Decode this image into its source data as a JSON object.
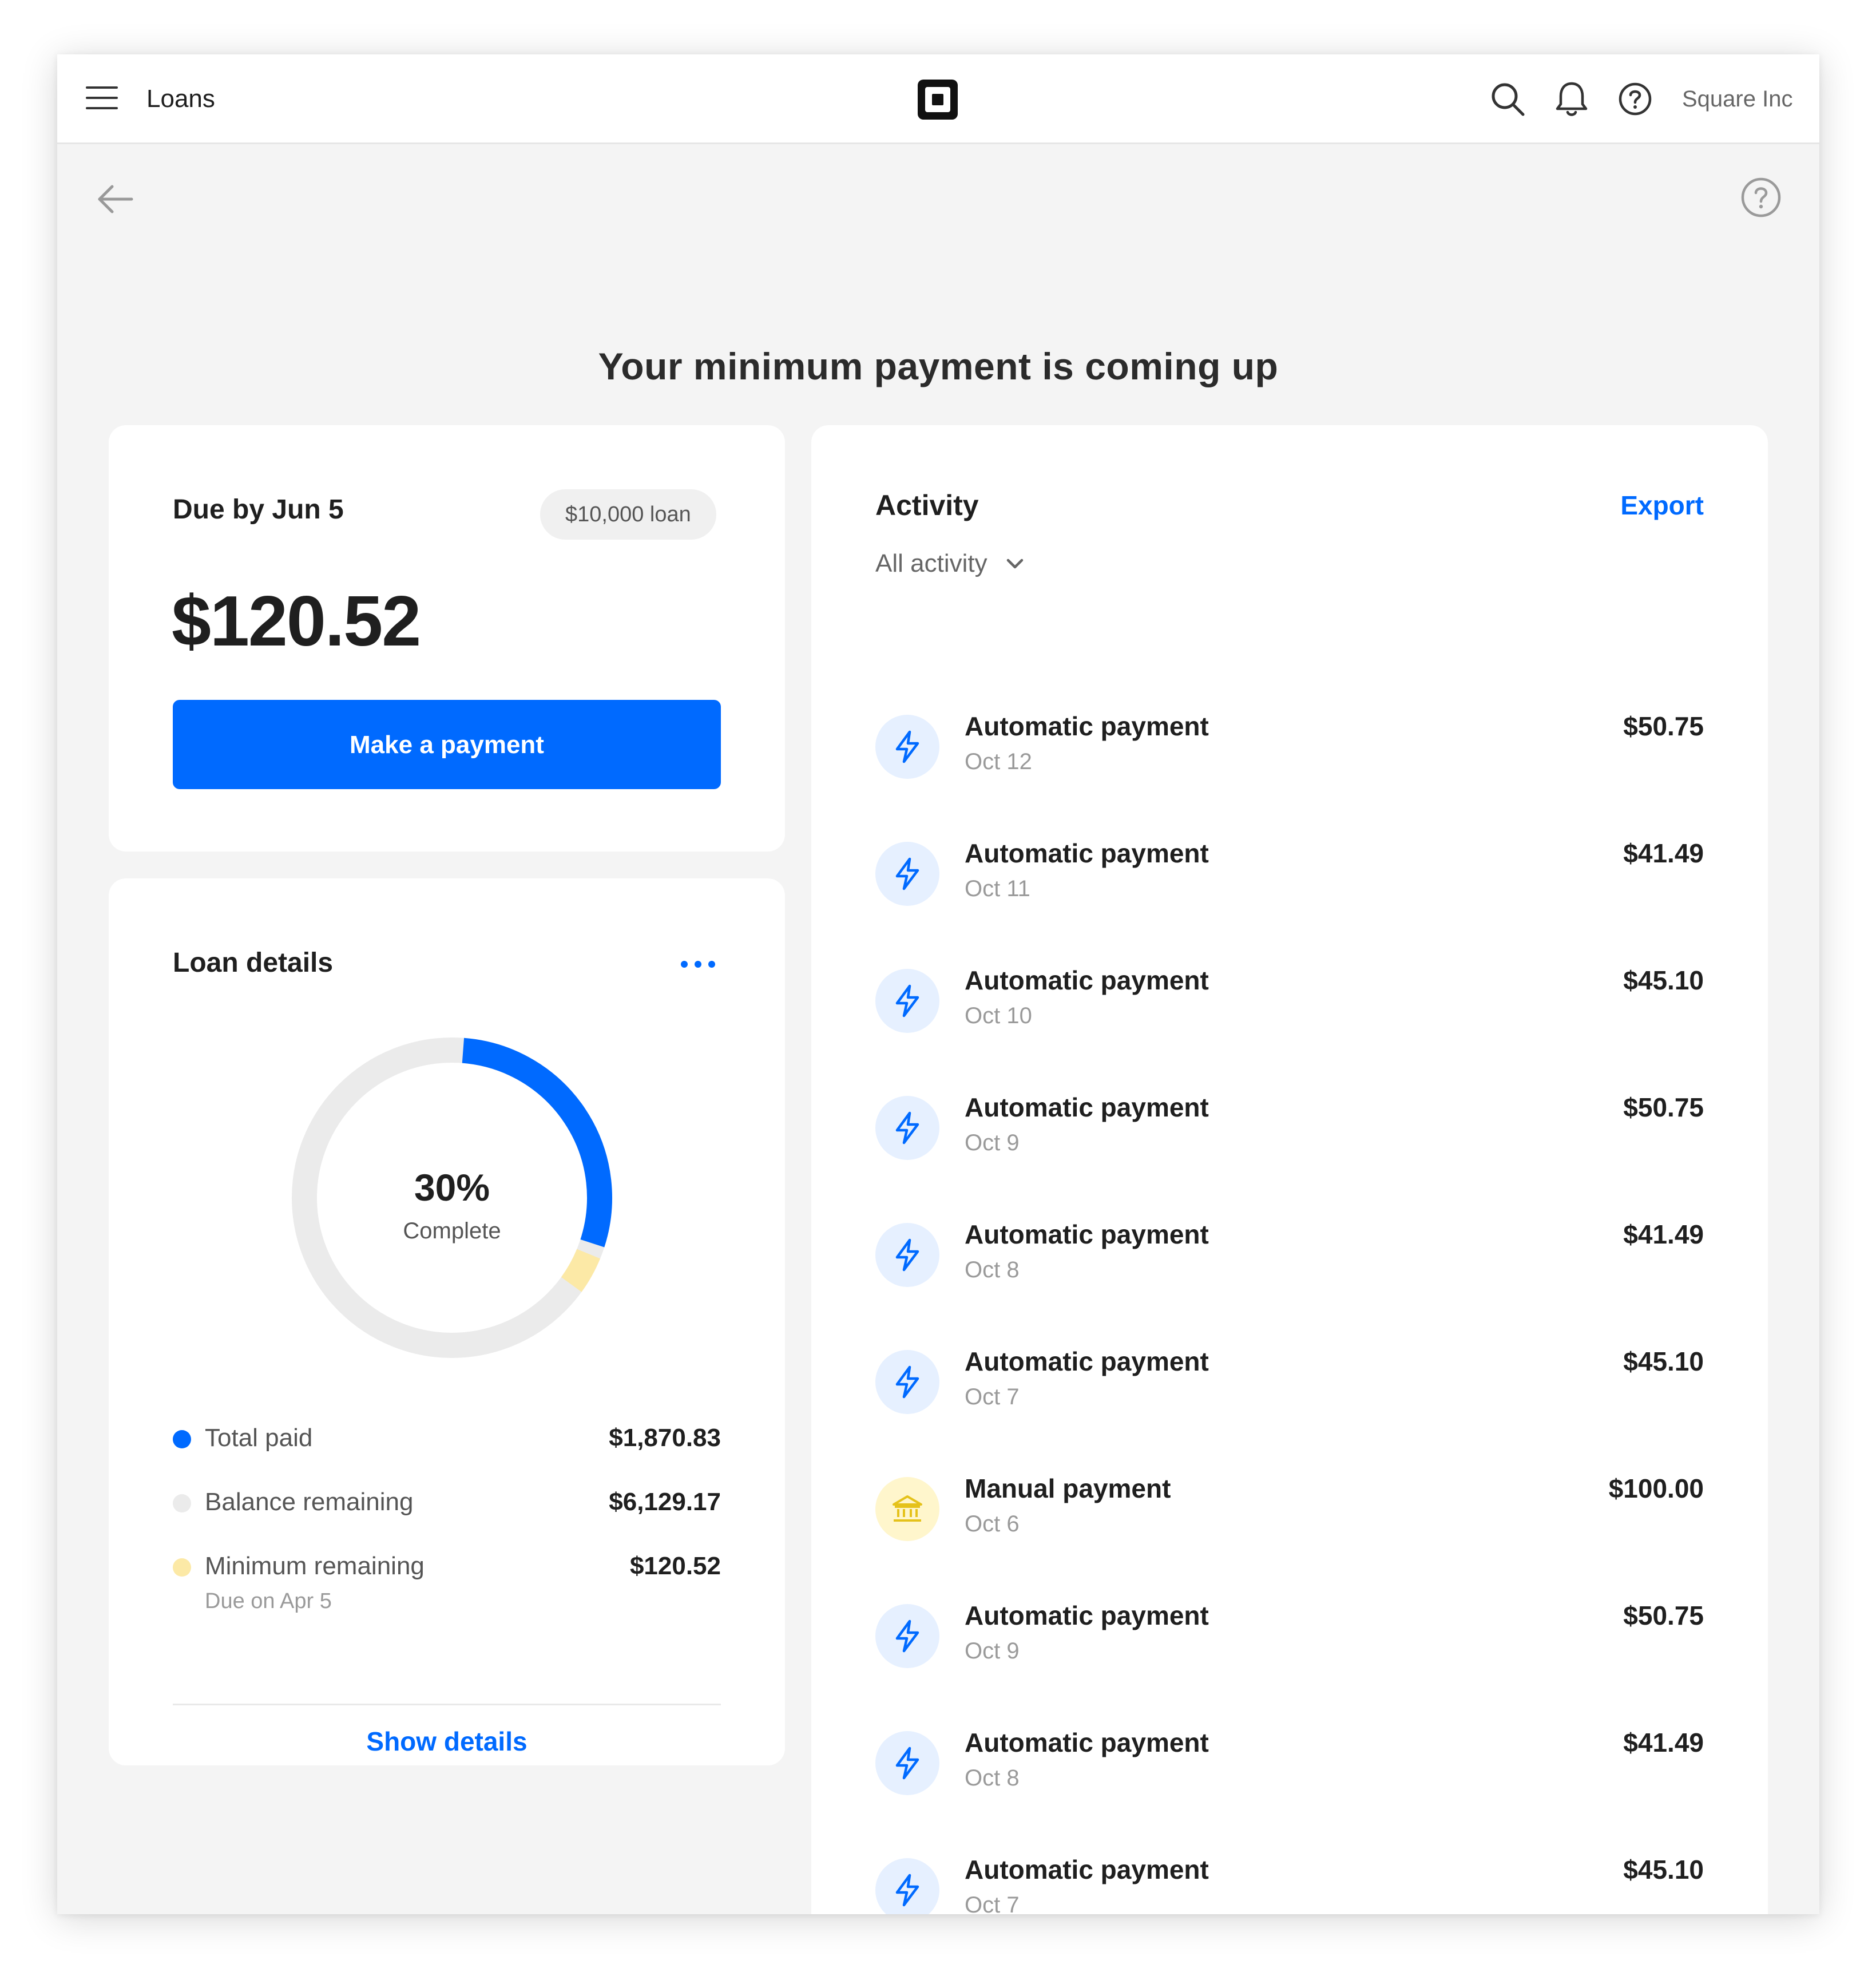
{
  "header": {
    "title": "Loans",
    "account_name": "Square Inc"
  },
  "page": {
    "title": "Your minimum payment is coming up"
  },
  "due_card": {
    "label": "Due by Jun 5",
    "loan_chip": "$10,000 loan",
    "amount": "$120.52",
    "pay_button": "Make a payment"
  },
  "loan_details": {
    "title": "Loan details",
    "percent_label": "30%",
    "percent_sub": "Complete",
    "progress": {
      "paid_fraction": 0.3,
      "minimum_fraction": 0.05
    },
    "legend": [
      {
        "label": "Total paid",
        "value": "$1,870.83",
        "color": "#006aff"
      },
      {
        "label": "Balance remaining",
        "value": "$6,129.17",
        "color": "#ebebeb"
      },
      {
        "label": "Minimum remaining",
        "value": "$120.52",
        "sub": "Due on Apr 5",
        "color": "#fce9a6"
      }
    ],
    "show_details": "Show details"
  },
  "activity": {
    "title": "Activity",
    "export_label": "Export",
    "filter_label": "All activity",
    "items": [
      {
        "title": "Automatic payment",
        "date": "Oct 12",
        "amount": "$50.75",
        "icon": "lightning-icon"
      },
      {
        "title": "Automatic payment",
        "date": "Oct 11",
        "amount": "$41.49",
        "icon": "lightning-icon"
      },
      {
        "title": "Automatic payment",
        "date": "Oct 10",
        "amount": "$45.10",
        "icon": "lightning-icon"
      },
      {
        "title": "Automatic payment",
        "date": "Oct 9",
        "amount": "$50.75",
        "icon": "lightning-icon"
      },
      {
        "title": "Automatic payment",
        "date": "Oct 8",
        "amount": "$41.49",
        "icon": "lightning-icon"
      },
      {
        "title": "Automatic payment",
        "date": "Oct 7",
        "amount": "$45.10",
        "icon": "lightning-icon"
      },
      {
        "title": "Manual payment",
        "date": "Oct 6",
        "amount": "$100.00",
        "icon": "bank-icon"
      },
      {
        "title": "Automatic payment",
        "date": "Oct 9",
        "amount": "$50.75",
        "icon": "lightning-icon"
      },
      {
        "title": "Automatic payment",
        "date": "Oct 8",
        "amount": "$41.49",
        "icon": "lightning-icon"
      },
      {
        "title": "Automatic payment",
        "date": "Oct 7",
        "amount": "$45.10",
        "icon": "lightning-icon"
      }
    ]
  },
  "colors": {
    "accent": "#006aff",
    "ring_track": "#ebebeb",
    "ring_minimum": "#fce9a6",
    "icon_blue_bg": "#e6f0ff",
    "icon_yellow_bg": "#fff6cc",
    "icon_yellow_fg": "#e5c21b"
  }
}
